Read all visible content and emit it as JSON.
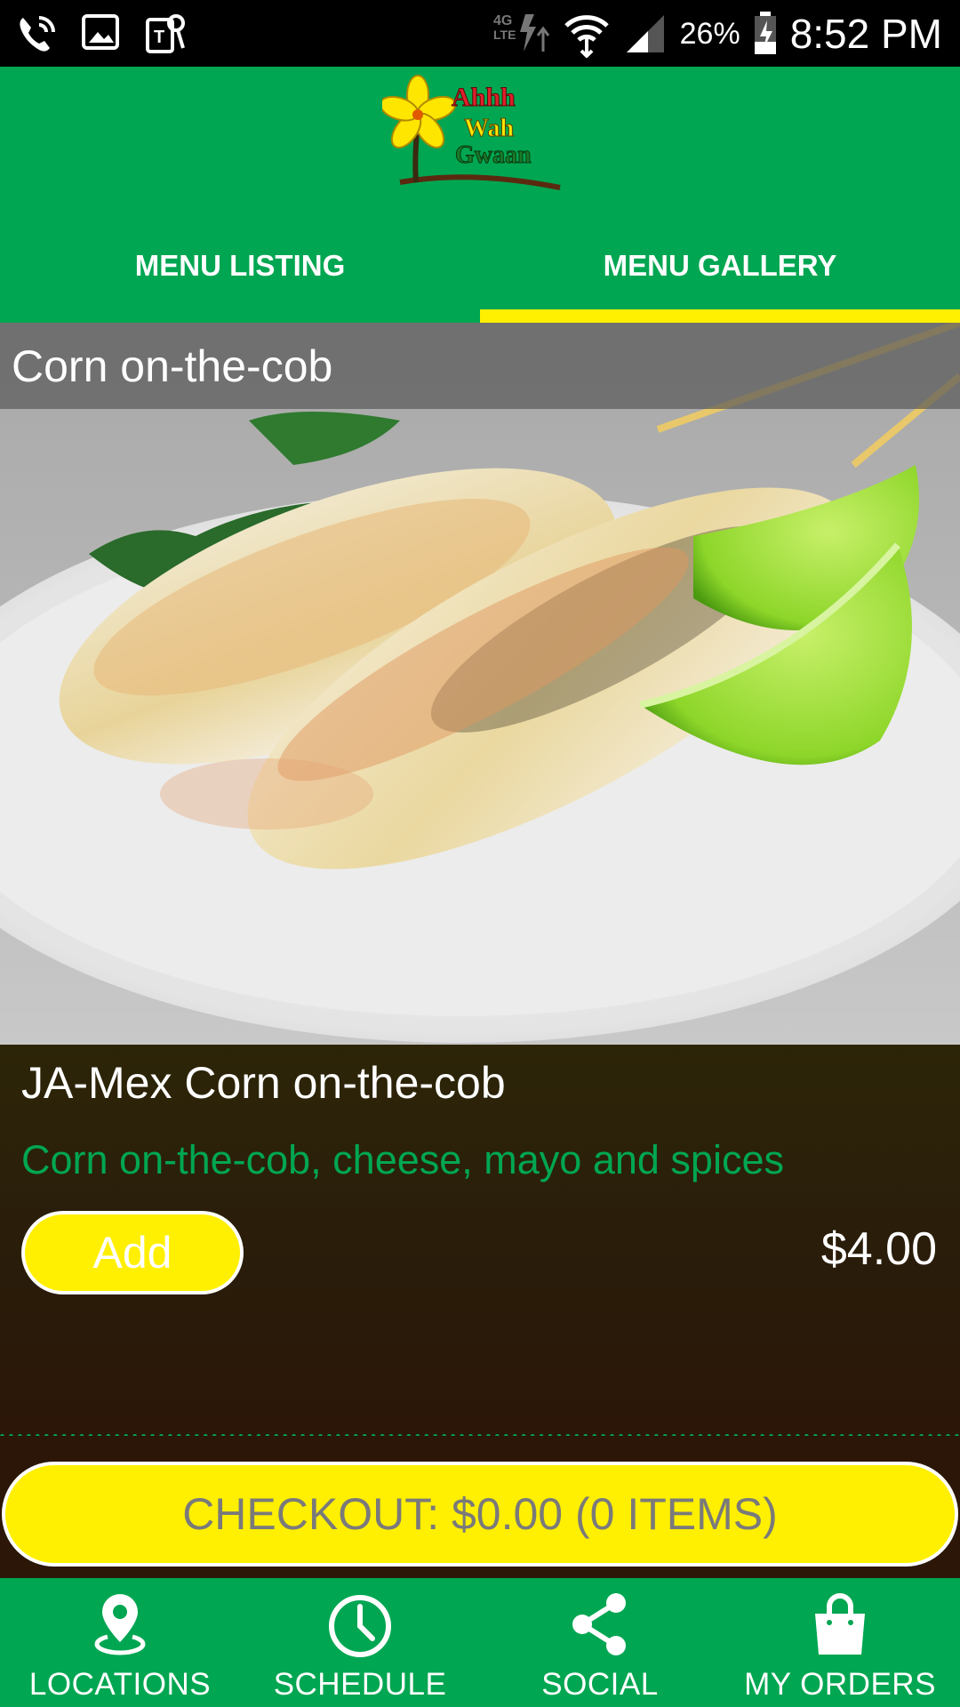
{
  "status_bar": {
    "battery_percent": "26%",
    "time": "8:52 PM",
    "network": "4G LTE"
  },
  "app": {
    "brand_color": "#00a651",
    "accent_color": "#ffef00",
    "logo": {
      "line1": "Ahhh",
      "line2": "Wah",
      "line3": "Gwaan"
    }
  },
  "tabs": [
    {
      "label": "MENU LISTING",
      "selected": false
    },
    {
      "label": "MENU GALLERY",
      "selected": true
    }
  ],
  "gallery": {
    "photo_caption": "Corn on-the-cob",
    "item_title": "JA-Mex Corn on-the-cob",
    "item_description": "Corn on-the-cob, cheese, mayo and spices",
    "add_label": "Add",
    "price": "$4.00"
  },
  "checkout": {
    "label": "CHECKOUT: $0.00 (0 ITEMS)"
  },
  "bottom_nav": [
    {
      "label": "LOCATIONS",
      "icon": "location-pin-icon"
    },
    {
      "label": "SCHEDULE",
      "icon": "clock-icon"
    },
    {
      "label": "SOCIAL",
      "icon": "share-icon"
    },
    {
      "label": "MY ORDERS",
      "icon": "shopping-bag-icon"
    }
  ]
}
